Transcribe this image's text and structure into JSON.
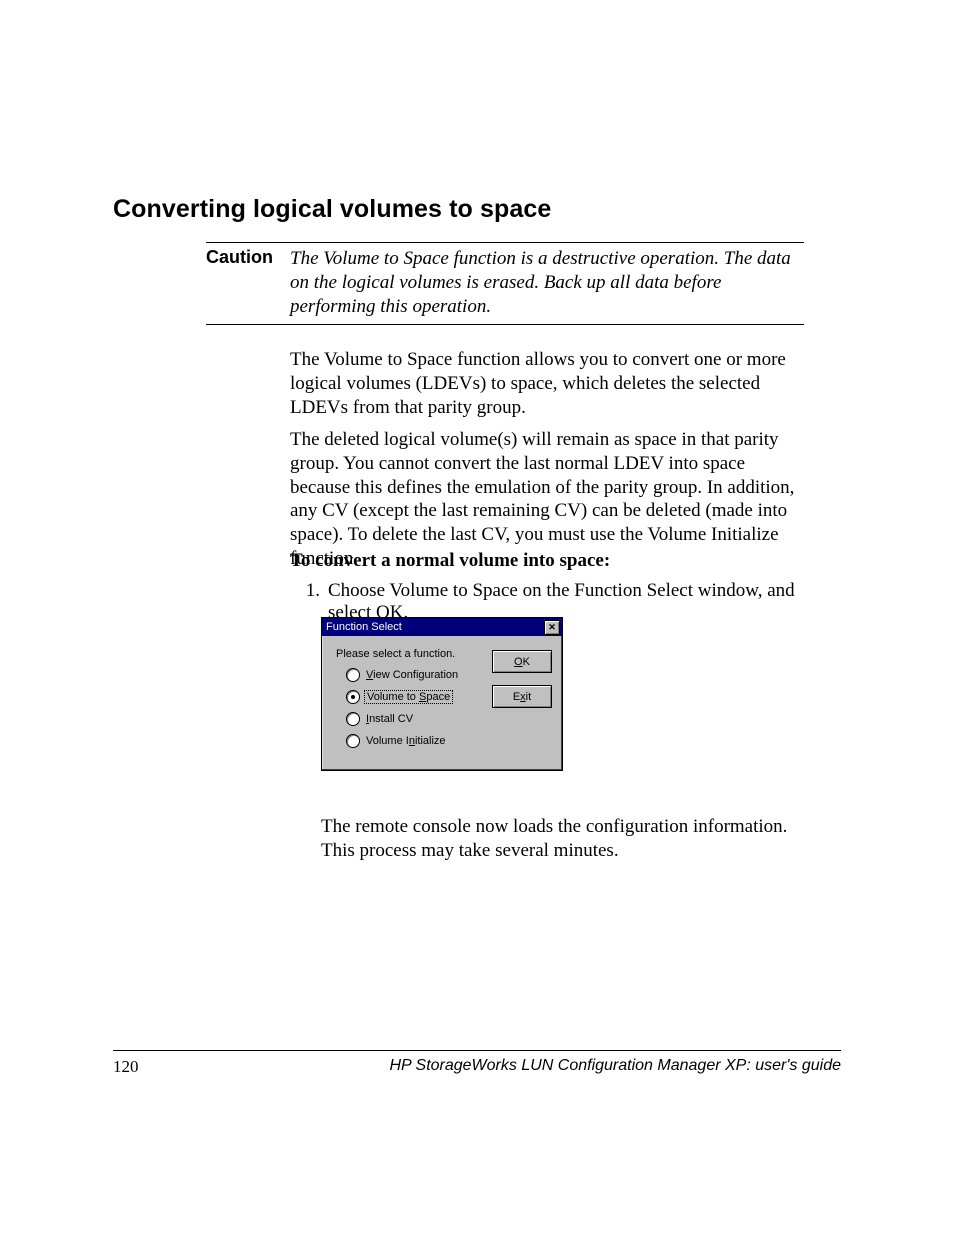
{
  "heading": "Converting logical volumes to space",
  "caution": {
    "label": "Caution",
    "text": "The Volume to Space function is a destructive operation. The data on the logical volumes is erased. Back up all data before performing this operation."
  },
  "para1": "The Volume to Space function allows you to convert one or more logical volumes (LDEVs) to space, which deletes the selected LDEVs from that parity group.",
  "para2": "The deleted logical volume(s) will remain as space in that parity group. You cannot convert the last normal LDEV into space because this defines the emulation of the parity group. In addition, any CV (except the last remaining CV) can be deleted (made into space). To delete the last CV, you must use the Volume Initialize function.",
  "procTitle": "To convert a normal volume into space:",
  "step1_num": "1.",
  "step1_text": "Choose Volume to Space on the Function Select window, and select OK.",
  "dialog": {
    "title": "Function Select",
    "close_glyph": "✕",
    "prompt": "Please select a function.",
    "options": {
      "view_pre": "V",
      "view_rest": "iew Configuration",
      "v2s_pre": "Volume to ",
      "v2s_ul": "S",
      "v2s_rest": "pace",
      "inst_ul": "I",
      "inst_rest": "nstall CV",
      "vi_pre": "Volume I",
      "vi_ul": "n",
      "vi_rest": "itialize"
    },
    "ok_ul": "O",
    "ok_rest": "K",
    "exit_pre": "E",
    "exit_ul": "x",
    "exit_rest": "it"
  },
  "afterDialog": "The remote console now loads the configuration information. This process may take several minutes.",
  "footer": {
    "page": "120",
    "guide": "HP StorageWorks LUN Configuration Manager XP: user's guide"
  }
}
